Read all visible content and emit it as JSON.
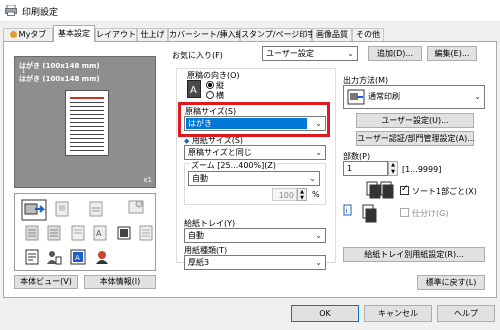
{
  "window": {
    "title": "印刷設定"
  },
  "tabs": [
    "Myタブ",
    "基本設定",
    "レイアウト",
    "仕上げ",
    "カバーシート/挿入紙",
    "スタンプ/ページ印字",
    "画像品質",
    "その他"
  ],
  "preview": {
    "line1": "はがき (100x148 mm)",
    "arrow": "↓",
    "line2": "はがき (100x148 mm)",
    "scale": "x1"
  },
  "left_buttons": {
    "printer_view": "本体ビュー(V)",
    "printer_info": "本体情報(I)"
  },
  "favorites": {
    "label": "お気に入り(F)",
    "value": "ユーザー設定",
    "add": "追加(D)...",
    "edit": "編集(E)..."
  },
  "orientation": {
    "label": "原稿の向き(O)",
    "portrait": "縦",
    "landscape": "横",
    "selected": "portrait"
  },
  "original_size": {
    "label": "原稿サイズ(S)",
    "value": "はがき"
  },
  "paper_size": {
    "label": "用紙サイズ(S)",
    "value": "原稿サイズと同じ"
  },
  "zoom": {
    "label": "ズーム [25...400%](Z)",
    "value": "自動",
    "percent": "100",
    "unit": "%"
  },
  "paper_tray": {
    "label": "給紙トレイ(Y)",
    "value": "自動"
  },
  "paper_type": {
    "label": "用紙種類(T)",
    "value": "厚紙3"
  },
  "output": {
    "label": "出力方法(M)",
    "value": "通常印刷",
    "user_settings": "ユーザー設定(U)...",
    "auth": "ユーザー認証/部門管理設定(A)..."
  },
  "copies": {
    "label": "部数(P)",
    "value": "1",
    "range": "[1...9999]",
    "collate": "ソート1部ごと(X)",
    "offset": "仕分け(G)"
  },
  "tray_settings": "給紙トレイ別用紙設定(R)...",
  "default_button": "標準に戻す(L)",
  "footer": {
    "ok": "OK",
    "cancel": "キャンセル",
    "help": "ヘルプ"
  }
}
